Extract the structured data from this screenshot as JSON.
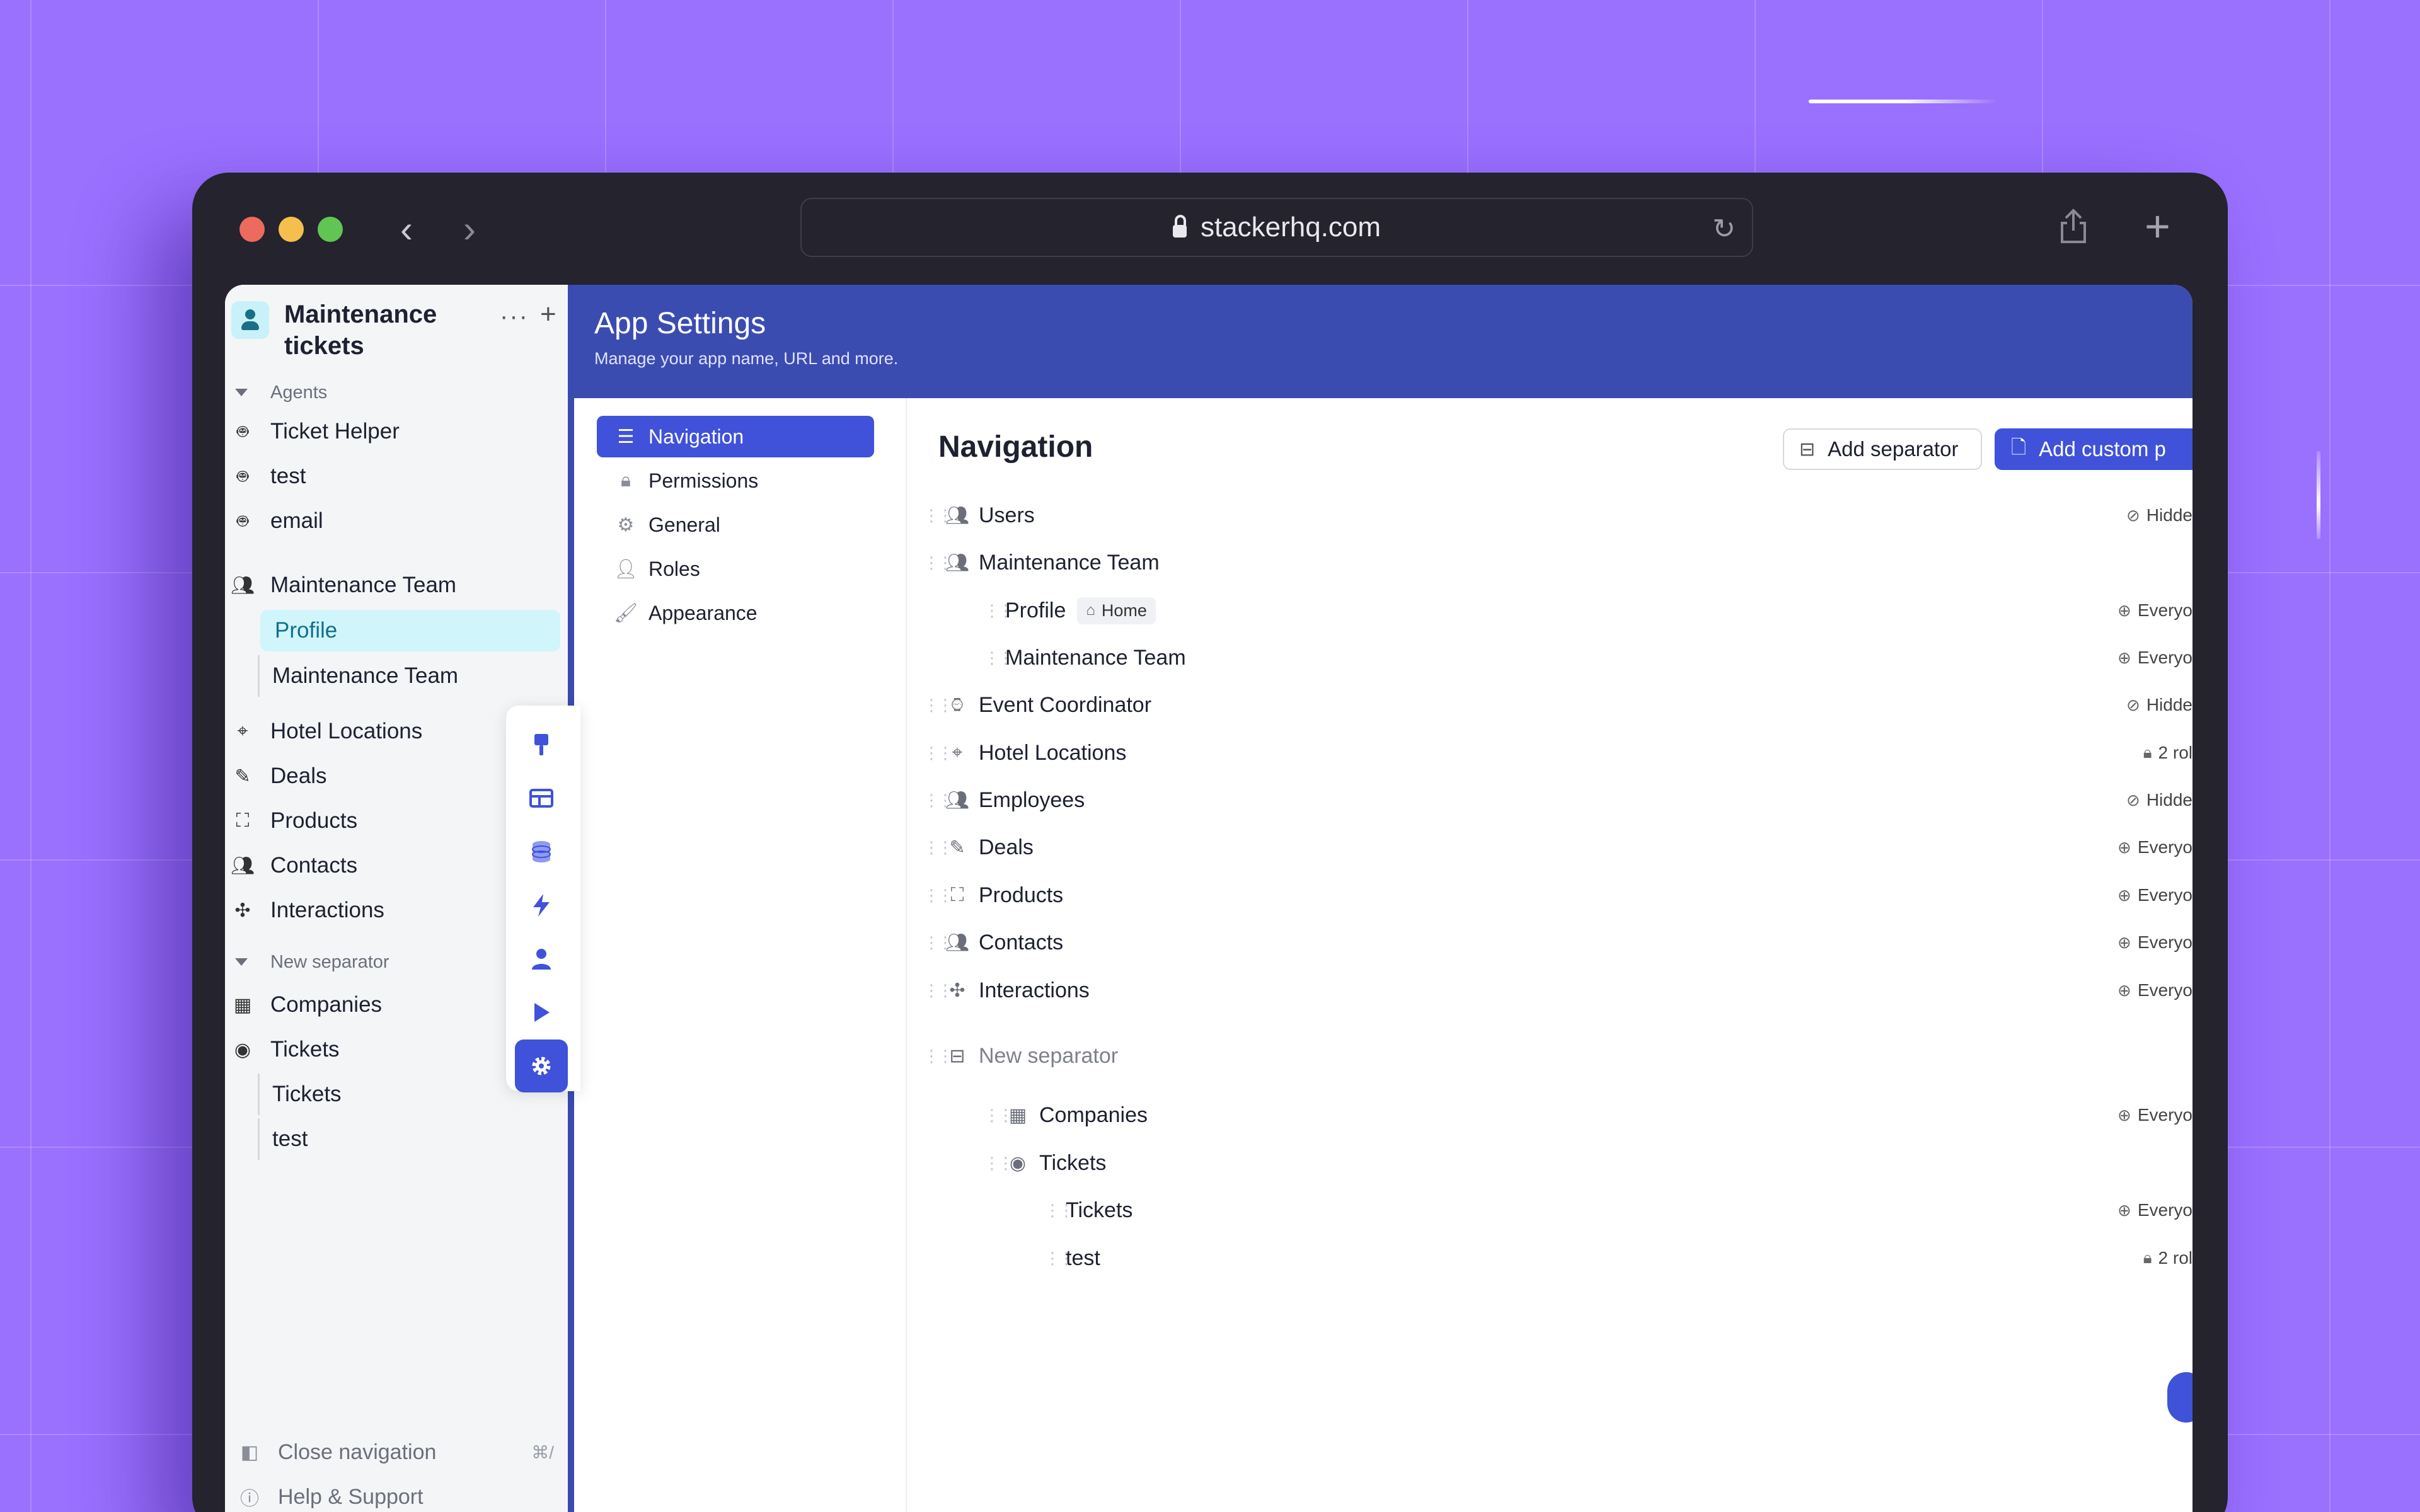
{
  "browser": {
    "url": "stackerhq.com",
    "back_icon": "‹",
    "forward_icon": "›",
    "new_tab_icon": "+"
  },
  "sidebar": {
    "app_title": "Maintenance tickets",
    "more_label": "···",
    "add_label": "+",
    "sections": [
      {
        "label": "Agents"
      },
      {
        "label": "New separator"
      }
    ],
    "agents": [
      {
        "label": "Ticket Helper",
        "icon": "robot-icon"
      },
      {
        "label": "test",
        "icon": "robot-icon"
      },
      {
        "label": "email",
        "icon": "robot-icon"
      }
    ],
    "maintenance_team": {
      "label": "Maintenance Team",
      "icon": "team-icon"
    },
    "maintenance_children": [
      {
        "label": "Profile",
        "active": true
      },
      {
        "label": "Maintenance Team",
        "active": false
      }
    ],
    "items": [
      {
        "label": "Hotel Locations",
        "icon": "location-pin-icon"
      },
      {
        "label": "Deals",
        "icon": "deal-icon"
      },
      {
        "label": "Products",
        "icon": "product-icon"
      },
      {
        "label": "Contacts",
        "icon": "team-icon"
      },
      {
        "label": "Interactions",
        "icon": "interaction-icon"
      }
    ],
    "sep_items": [
      {
        "label": "Companies",
        "icon": "building-icon"
      },
      {
        "label": "Tickets",
        "icon": "target-icon"
      }
    ],
    "ticket_children": [
      {
        "label": "Tickets"
      },
      {
        "label": "test"
      }
    ],
    "footer": {
      "close_nav": "Close navigation",
      "close_nav_shortcut": "⌘/",
      "help": "Help & Support"
    }
  },
  "settings": {
    "title": "App Settings",
    "subtitle": "Manage your app name, URL and more.",
    "nav": [
      {
        "label": "Navigation",
        "icon": "list-icon",
        "active": true
      },
      {
        "label": "Permissions",
        "icon": "lock-icon",
        "active": false
      },
      {
        "label": "General",
        "icon": "gear-icon",
        "active": false
      },
      {
        "label": "Roles",
        "icon": "user-lock-icon",
        "active": false
      },
      {
        "label": "Appearance",
        "icon": "paintbrush-icon",
        "active": false
      }
    ]
  },
  "content": {
    "title": "Navigation",
    "add_separator": "Add separator",
    "add_custom": "Add custom p",
    "rows": [
      {
        "label": "Users",
        "icon": "team-icon",
        "perm": "Hidde",
        "perm_icon": "eye-off-icon",
        "level": 0
      },
      {
        "label": "Maintenance Team",
        "icon": "team-icon",
        "perm": "",
        "perm_icon": "",
        "level": 0
      },
      {
        "label": "Profile",
        "icon": "",
        "perm": "Everyo",
        "perm_icon": "globe-icon",
        "level": 1,
        "badge": "Home"
      },
      {
        "label": "Maintenance Team",
        "icon": "",
        "perm": "Everyo",
        "perm_icon": "globe-icon",
        "level": 1
      },
      {
        "label": "Event Coordinator",
        "icon": "watch-icon",
        "perm": "Hidde",
        "perm_icon": "eye-off-icon",
        "level": 0
      },
      {
        "label": "Hotel Locations",
        "icon": "location-pin-icon",
        "perm": "2 rol",
        "perm_icon": "lock-icon",
        "level": 0
      },
      {
        "label": "Employees",
        "icon": "team-icon",
        "perm": "Hidde",
        "perm_icon": "eye-off-icon",
        "level": 0
      },
      {
        "label": "Deals",
        "icon": "deal-icon",
        "perm": "Everyo",
        "perm_icon": "globe-icon",
        "level": 0
      },
      {
        "label": "Products",
        "icon": "product-icon",
        "perm": "Everyo",
        "perm_icon": "globe-icon",
        "level": 0
      },
      {
        "label": "Contacts",
        "icon": "team-icon",
        "perm": "Everyo",
        "perm_icon": "globe-icon",
        "level": 0
      },
      {
        "label": "Interactions",
        "icon": "interaction-icon",
        "perm": "Everyo",
        "perm_icon": "globe-icon",
        "level": 0
      },
      {
        "label": "New separator",
        "icon": "separator-icon",
        "perm": "",
        "perm_icon": "",
        "level": 0,
        "separator": true
      },
      {
        "label": "Companies",
        "icon": "building-icon",
        "perm": "Everyo",
        "perm_icon": "globe-icon",
        "level": 1
      },
      {
        "label": "Tickets",
        "icon": "target-icon",
        "perm": "",
        "perm_icon": "",
        "level": 1
      },
      {
        "label": "Tickets",
        "icon": "",
        "perm": "Everyo",
        "perm_icon": "globe-icon",
        "level": 2
      },
      {
        "label": "test",
        "icon": "",
        "perm": "2 rol",
        "perm_icon": "lock-icon",
        "level": 2
      }
    ]
  },
  "colors": {
    "background": "#9a70ff",
    "accent": "#3f52d9",
    "header": "#3b4cb1",
    "active_nav_bg": "#d0f5fb"
  }
}
